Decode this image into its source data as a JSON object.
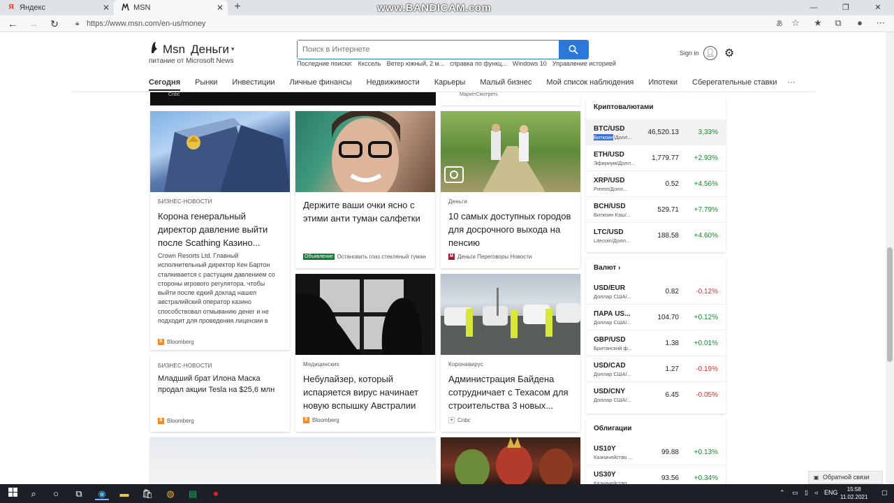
{
  "browser": {
    "tabs": [
      {
        "title": "Яндекс",
        "favicon": "Я"
      },
      {
        "title": "MSN",
        "favicon": "msn-icon"
      }
    ],
    "new_tab": "+",
    "watermark": "www.BANDICAM.com",
    "url": "https://www.msn.com/en-us/money"
  },
  "header": {
    "logo": "Msn",
    "section": "Деньги",
    "powered_by": "питание от Microsoft News",
    "search_placeholder": "Поиск в Интернете",
    "recent_label": "Последние поиски:",
    "recent_items": [
      "Кксcель",
      "Ветер южный, 2 м...",
      "справка по функц...",
      "Windows 10",
      "Управление историей"
    ],
    "signin": "Sign in"
  },
  "nav": {
    "items": [
      "Сегодня",
      "Рынки",
      "Инвестиции",
      "Личные финансы",
      "Недвижимости",
      "Карьеры",
      "Малый бизнес",
      "Мой список наблюдения",
      "Ипотеки",
      "Сберегательные ставки"
    ],
    "active": "Сегодня",
    "more": "···"
  },
  "top_strip": {
    "left_source": "Cnbc",
    "right_source": "МаркетСмотреть"
  },
  "cards": [
    {
      "category": "БИЗНЕС-НОВОСТИ",
      "title": "Корона генеральный директор давление выйти после Scathing Казино...",
      "body": "Crown Resorts Ltd. Главный исполнительный директор Кен Бартон сталкивается с растущим давлением со стороны игрового регулятора. чтобы выйти после едкий доклад нашел австралийский оператор казино способствовал отмыванию денег и не подходит для проведения лицензии в Сиднее.",
      "source": "Bloomberg"
    },
    {
      "title": "Держите ваши очки ясно с этими анти туман салфетки",
      "ad_label": "Объявление",
      "source": "Остановить глаз стекляный туман"
    },
    {
      "category": "Деньги",
      "title": "10 самых доступных городов для досрочного выхода на пенсию",
      "source": "Деньги Переговоры Новости"
    },
    {
      "category": "БИЗНЕС-НОВОСТИ",
      "title": "Младший брат Илона Маска продал акции Tesla на $25,6 млн",
      "source": "Bloomberg"
    },
    {
      "category": "Медицинских",
      "title": "Небулайзер, который испаряется вирус начинает новую вспышку Австралии",
      "source": "Bloomberg"
    },
    {
      "category": "Коронавирус",
      "title": "Администрация Байдена сотрудничает с Техасом для строительства 3 новых...",
      "source": "Cnbc"
    }
  ],
  "crypto": {
    "title": "Криптовалютами",
    "rows": [
      {
        "sym": "BTC/USD",
        "desc_sel": "Биткоин",
        "desc": "/Долл...",
        "val": "46,520.13",
        "chg": "3,33%",
        "dir": "pos"
      },
      {
        "sym": "ETH/USD",
        "desc": "Эфириум/Долл...",
        "val": "1,779.77",
        "chg": "+2.93%",
        "dir": "pos"
      },
      {
        "sym": "XRP/USD",
        "desc": "Риппл/Долл...",
        "val": "0.52",
        "chg": "+4.56%",
        "dir": "pos"
      },
      {
        "sym": "BCH/USD",
        "desc": "Биткоин Кэш/...",
        "val": "529.71",
        "chg": "+7.79%",
        "dir": "pos"
      },
      {
        "sym": "LTC/USD",
        "desc": "Litecoin/Долл...",
        "val": "188.58",
        "chg": "+4.60%",
        "dir": "pos"
      }
    ]
  },
  "currency": {
    "title": "Валют",
    "rows": [
      {
        "sym": "USD/EUR",
        "desc": "Доллар США/...",
        "val": "0.82",
        "chg": "-0.12%",
        "dir": "neg"
      },
      {
        "sym": "ПАРА US...",
        "desc": "Доллар США/...",
        "val": "104.70",
        "chg": "+0.12%",
        "dir": "pos"
      },
      {
        "sym": "GBP/USD",
        "desc": "Британский ф...",
        "val": "1.38",
        "chg": "+0.01%",
        "dir": "pos"
      },
      {
        "sym": "USD/CAD",
        "desc": "Доллар США/...",
        "val": "1.27",
        "chg": "-0.19%",
        "dir": "neg"
      },
      {
        "sym": "USD/CNY",
        "desc": "Доллар США/...",
        "val": "6.45",
        "chg": "-0.05%",
        "dir": "neg"
      }
    ]
  },
  "bonds": {
    "title": "Облигации",
    "rows": [
      {
        "sym": "US10Y",
        "desc": "Казначейство ...",
        "val": "99.88",
        "chg": "+0.13%",
        "dir": "pos"
      },
      {
        "sym": "US30Y",
        "desc": "Казначейство ...",
        "val": "93.56",
        "chg": "+0.34%",
        "dir": "pos"
      }
    ]
  },
  "feedback": "Обратной связи",
  "taskbar": {
    "lang": "ENG",
    "time": "15:58",
    "date": "11.02.2021"
  },
  "colors": {
    "accent": "#2c77d8",
    "positive": "#118a2d",
    "negative": "#d12f2f"
  }
}
